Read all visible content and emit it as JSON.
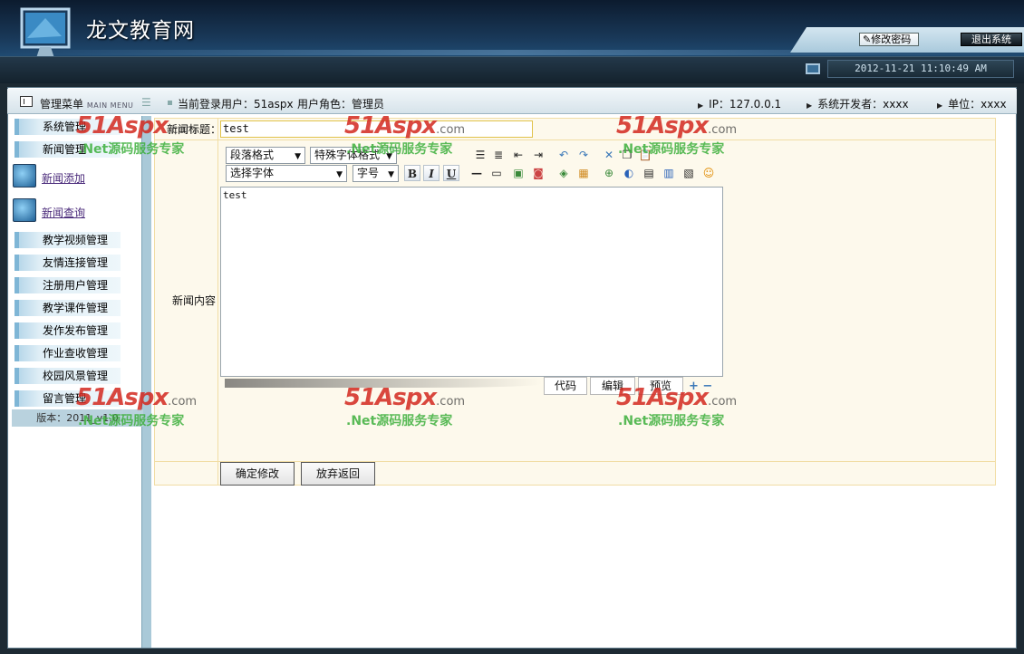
{
  "header": {
    "title": "龙文教育网",
    "change_password": "修改密码",
    "logout": "退出系统",
    "datetime": "2012-11-21 11:10:49 AM"
  },
  "infobar": {
    "menu_label": "管理菜单",
    "menu_en": "MAIN MENU",
    "current_user": "当前登录用户：51aspx",
    "user_role": "用户角色：管理员",
    "ip": "IP：127.0.0.1",
    "developer": "系统开发者：xxxx",
    "unit": "单位：xxxx"
  },
  "sidebar": {
    "system": "系统管理",
    "news": "新闻管理",
    "news_add": "新闻添加",
    "news_query": "新闻查询",
    "sections": [
      "教学视频管理",
      "友情连接管理",
      "注册用户管理",
      "教学课件管理",
      "发作发布管理",
      "作业查收管理",
      "校园风景管理",
      "留言管理"
    ],
    "version": "版本：2011_v1.0"
  },
  "form": {
    "title_label": "新闻标题：",
    "title_value": "test",
    "content_label": "新闻内容",
    "content_value": "test",
    "confirm": "确定修改",
    "cancel": "放弃返回"
  },
  "editor": {
    "paragraph": "段落格式",
    "special": "特殊字体格式",
    "font": "选择字体",
    "size": "字号",
    "bold": "B",
    "italic": "I",
    "underline": "U",
    "tab_code": "代码",
    "tab_edit": "编辑",
    "tab_preview": "预览"
  },
  "watermark": {
    "brand": "51Aspx",
    "domain": ".com",
    "slogan": ".Net源码服务专家"
  }
}
